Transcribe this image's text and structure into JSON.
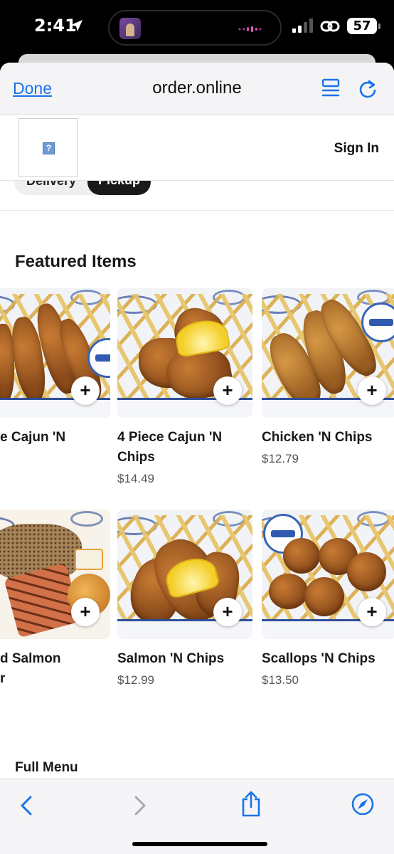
{
  "status_bar": {
    "time": "2:41",
    "battery": "57"
  },
  "browser": {
    "done_label": "Done",
    "url": "order.online"
  },
  "site": {
    "sign_in": "Sign In",
    "logo_glyph": "?",
    "modes": [
      "Delivery",
      "Pickup"
    ],
    "selected_mode": "Pickup"
  },
  "featured": {
    "title": "Featured Items",
    "items": [
      {
        "name": "e Cajun 'N",
        "price": ""
      },
      {
        "name": "4 Piece Cajun 'N Chips",
        "price": "$14.49"
      },
      {
        "name": "Chicken 'N Chips",
        "price": "$12.79"
      },
      {
        "name": "d Salmon\nr",
        "price": ""
      },
      {
        "name": "Salmon 'N Chips",
        "price": "$12.99"
      },
      {
        "name": "Scallops 'N Chips",
        "price": "$13.50"
      }
    ],
    "add_label": "+"
  },
  "full_menu": {
    "title": "Full Menu"
  },
  "colors": {
    "link_blue": "#1a73e8",
    "pickup_bg": "#191919",
    "toolbar_icon": "#1a73e8"
  },
  "icons": [
    "location-arrow-icon",
    "signal-icon",
    "link-icon",
    "reader-icon",
    "reload-icon",
    "back-icon",
    "forward-icon",
    "share-icon",
    "compass-icon"
  ]
}
